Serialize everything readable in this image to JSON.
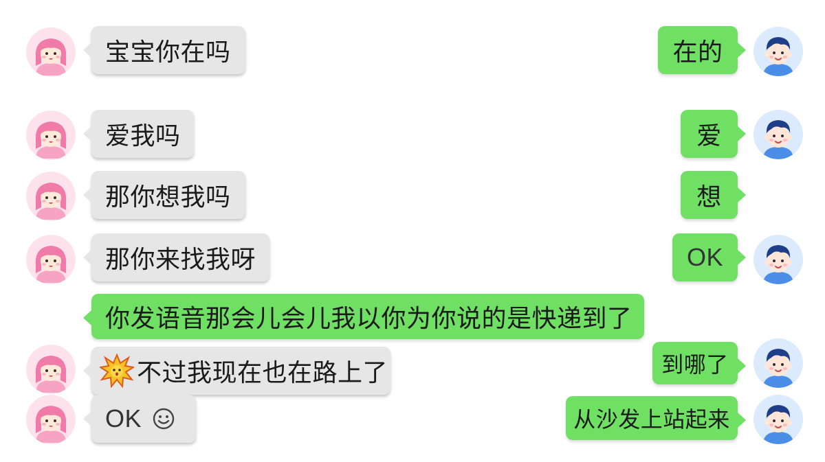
{
  "conversation": {
    "messages": [
      {
        "sender": "girl",
        "text": "宝宝你在吗"
      },
      {
        "sender": "boy",
        "text": "在的"
      },
      {
        "sender": "girl",
        "text": "爱我吗"
      },
      {
        "sender": "boy",
        "text": "爱"
      },
      {
        "sender": "girl",
        "text": "那你想我吗"
      },
      {
        "sender": "boy",
        "text": "想"
      },
      {
        "sender": "girl",
        "text": "那你来找我呀"
      },
      {
        "sender": "boy",
        "text": "OK"
      },
      {
        "sender": "boy",
        "text": "你发语音那会儿会儿我以你为你说的是快递到了"
      },
      {
        "sender": "girl",
        "text": "不过我现在也在路上了",
        "emoji": "explosion-face"
      },
      {
        "sender": "boy",
        "text": "到哪了"
      },
      {
        "sender": "girl",
        "text": "OK",
        "emoji": "smiley-face"
      },
      {
        "sender": "boy",
        "text": "从沙发上站起来"
      }
    ]
  },
  "colors": {
    "incoming_bubble": "#e6e6e6",
    "outgoing_bubble": "#6fe063",
    "girl_avatar": "#f58ab0",
    "boy_avatar": "#4a8ee8"
  },
  "icons": {
    "girl_avatar": "girl-avatar-icon",
    "boy_avatar": "boy-avatar-icon",
    "explosion": "explosion-face-icon",
    "smiley": "smiley-face-icon"
  }
}
